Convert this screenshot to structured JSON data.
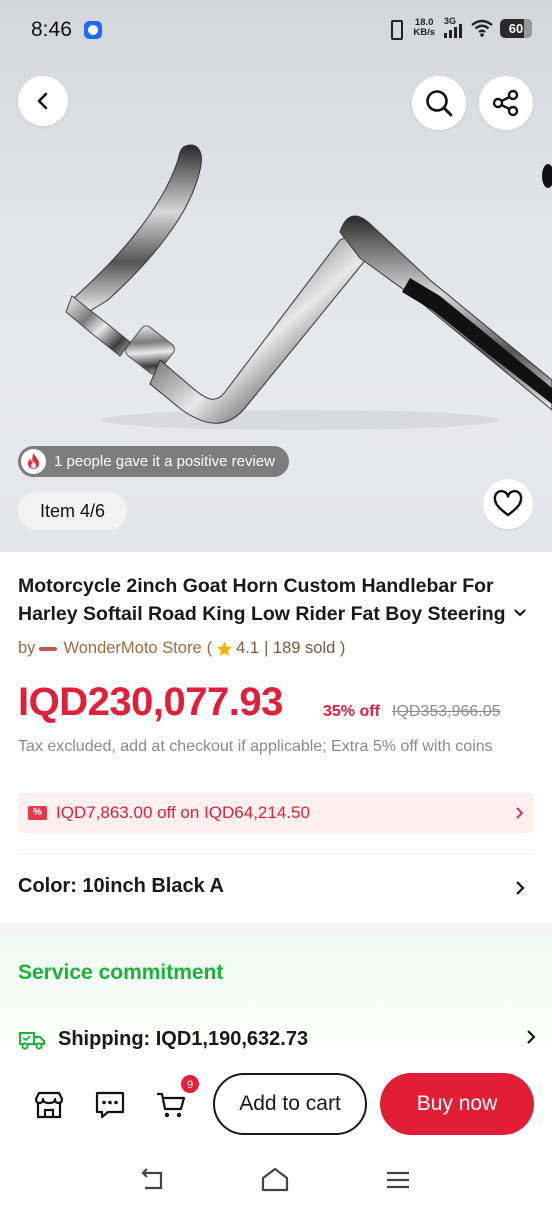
{
  "status_bar": {
    "time": "8:46",
    "net_speed_value": "18.0",
    "net_speed_unit": "KB/s",
    "network_type": "3G",
    "battery": "60"
  },
  "gallery": {
    "review_text": "1 people gave it a positive review",
    "item_counter": "Item 4/6"
  },
  "product": {
    "title": "Motorcycle 2inch Goat Horn Custom Handlebar For Harley Softail Road King Low Rider Fat Boy Steering",
    "store_prefix": "by",
    "store_name": "WonderMoto Store",
    "rating_open": "(",
    "rating": "4.1",
    "sold": "| 189 sold )",
    "price": "IQD230,077.93",
    "discount": "35% off",
    "original_price": "IQD353,966.05",
    "tax_note": "Tax excluded, add at checkout if applicable; Extra 5% off with coins"
  },
  "coupon": {
    "icon_text": "%",
    "text": "IQD7,863.00 off on IQD64,214.50"
  },
  "color_option": {
    "label": "Color: 10inch Black A"
  },
  "service": {
    "title": "Service commitment",
    "shipping": "Shipping: IQD1,190,632.73"
  },
  "action_bar": {
    "cart_count": "9",
    "add_to_cart": "Add to cart",
    "buy_now": "Buy now"
  },
  "colors": {
    "price_red": "#e0203b",
    "buy_button": "#e41d36",
    "service_green": "#19b338",
    "store_brown": "#a16a3c"
  }
}
